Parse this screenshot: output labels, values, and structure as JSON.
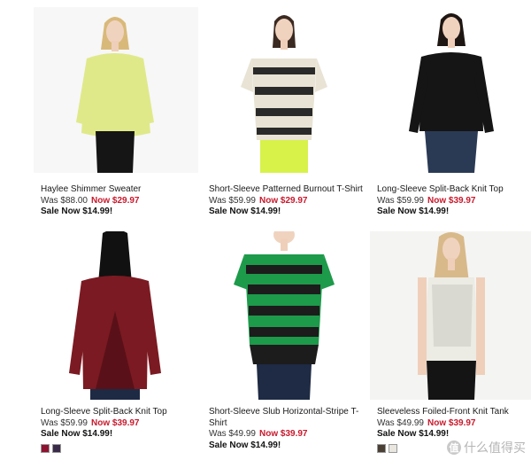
{
  "products": [
    {
      "name": "Haylee Shimmer Sweater",
      "was_label": "Was $88.00",
      "now_label": "Now $29.97",
      "sale": "Sale Now $14.99!",
      "garment_color": "#dfe98a"
    },
    {
      "name": "Short-Sleeve Patterned Burnout T-Shirt",
      "was_label": "Was $59.99",
      "now_label": "Now $29.97",
      "sale": "Sale Now $14.99!",
      "garment_color": "#2a2a2a"
    },
    {
      "name": "Long-Sleeve Split-Back Knit Top",
      "was_label": "Was $59.99",
      "now_label": "Now $39.97",
      "sale": "Sale Now $14.99!",
      "garment_color": "#151515"
    },
    {
      "name": "Long-Sleeve Split-Back Knit Top",
      "was_label": "Was $59.99",
      "now_label": "Now $39.97",
      "sale": "Sale Now $14.99!",
      "garment_color": "#7b1a22",
      "swatches": [
        "#8d1430",
        "#3a2a4a"
      ]
    },
    {
      "name": "Short-Sleeve Slub Horizontal-Stripe T-Shirt",
      "was_label": "Was $49.99",
      "now_label": "Now $39.97",
      "sale": "Sale Now $14.99!",
      "garment_color": "#1d9a4a"
    },
    {
      "name": "Sleeveless Foiled-Front Knit Tank",
      "was_label": "Was $49.99",
      "now_label": "Now $39.97",
      "sale": "Sale Now $14.99!",
      "garment_color": "#ecebe4",
      "swatches": [
        "#4a3f35",
        "#e9e6df"
      ]
    }
  ],
  "watermark": {
    "badge": "值",
    "text": "什么值得买"
  }
}
